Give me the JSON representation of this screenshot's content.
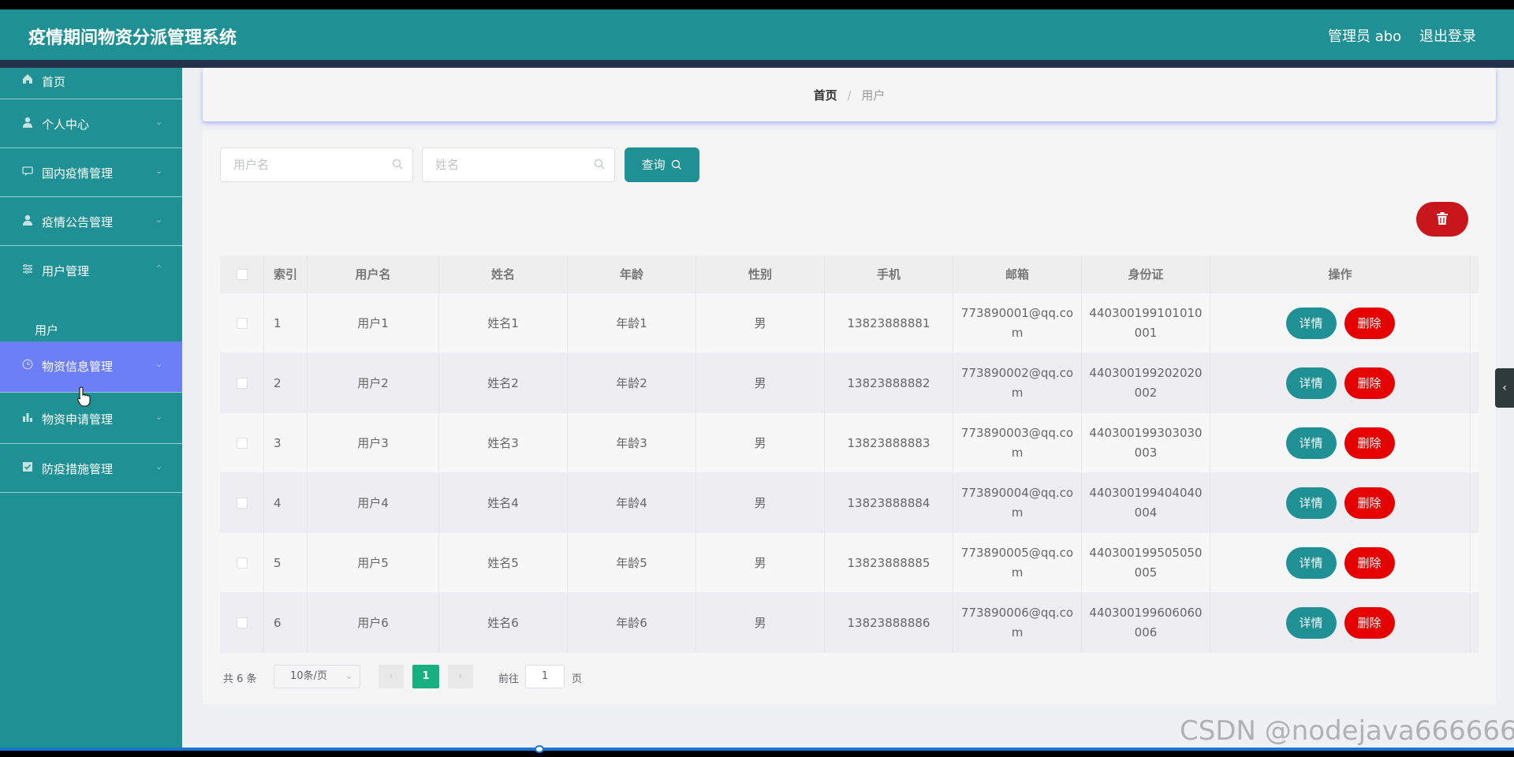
{
  "app": {
    "title": "疫情期间物资分派管理系统",
    "admin_label": "管理员 abo",
    "logout_label": "退出登录"
  },
  "sidebar": {
    "items": [
      {
        "label": "首页",
        "icon": "home-icon"
      },
      {
        "label": "个人中心",
        "icon": "user-icon"
      },
      {
        "label": "国内疫情管理",
        "icon": "chat-icon"
      },
      {
        "label": "疫情公告管理",
        "icon": "user-icon"
      },
      {
        "label": "用户管理",
        "icon": "sliders-icon"
      },
      {
        "label": "物资信息管理",
        "icon": "clock-icon"
      },
      {
        "label": "物资申请管理",
        "icon": "bar-chart-icon"
      },
      {
        "label": "防疫措施管理",
        "icon": "check-square-icon"
      }
    ],
    "sub_user": "用户",
    "active": "物资信息管理"
  },
  "breadcrumb": {
    "home": "首页",
    "separator": "/",
    "current": "用户"
  },
  "search": {
    "username_placeholder": "用户名",
    "name_placeholder": "姓名",
    "query_label": "查询"
  },
  "table": {
    "headers": [
      "索引",
      "用户名",
      "姓名",
      "年龄",
      "性别",
      "手机",
      "邮箱",
      "身份证",
      "操作"
    ],
    "rows": [
      {
        "index": "1",
        "username": "用户1",
        "name": "姓名1",
        "age": "年龄1",
        "gender": "男",
        "phone": "13823888881",
        "email": "773890001@qq.com",
        "idcard": "440300199101010001"
      },
      {
        "index": "2",
        "username": "用户2",
        "name": "姓名2",
        "age": "年龄2",
        "gender": "男",
        "phone": "13823888882",
        "email": "773890002@qq.com",
        "idcard": "440300199202020002"
      },
      {
        "index": "3",
        "username": "用户3",
        "name": "姓名3",
        "age": "年龄3",
        "gender": "男",
        "phone": "13823888883",
        "email": "773890003@qq.com",
        "idcard": "440300199303030003"
      },
      {
        "index": "4",
        "username": "用户4",
        "name": "姓名4",
        "age": "年龄4",
        "gender": "男",
        "phone": "13823888884",
        "email": "773890004@qq.com",
        "idcard": "440300199404040004"
      },
      {
        "index": "5",
        "username": "用户5",
        "name": "姓名5",
        "age": "年龄5",
        "gender": "男",
        "phone": "13823888885",
        "email": "773890005@qq.com",
        "idcard": "440300199505050005"
      },
      {
        "index": "6",
        "username": "用户6",
        "name": "姓名6",
        "age": "年龄6",
        "gender": "男",
        "phone": "13823888886",
        "email": "773890006@qq.com",
        "idcard": "440300199606060006"
      }
    ],
    "detail_label": "详情",
    "delete_label": "删除"
  },
  "pagination": {
    "total": "共 6 条",
    "page_size": "10条/页",
    "current_page": "1",
    "goto_label": "前往",
    "goto_value": "1",
    "page_unit": "页"
  },
  "watermark": "CSDN @nodejava666666",
  "colors": {
    "primary": "#1f9094",
    "active_menu": "#6c7ff6",
    "danger": "#e60000",
    "page_active": "#19b07f"
  }
}
